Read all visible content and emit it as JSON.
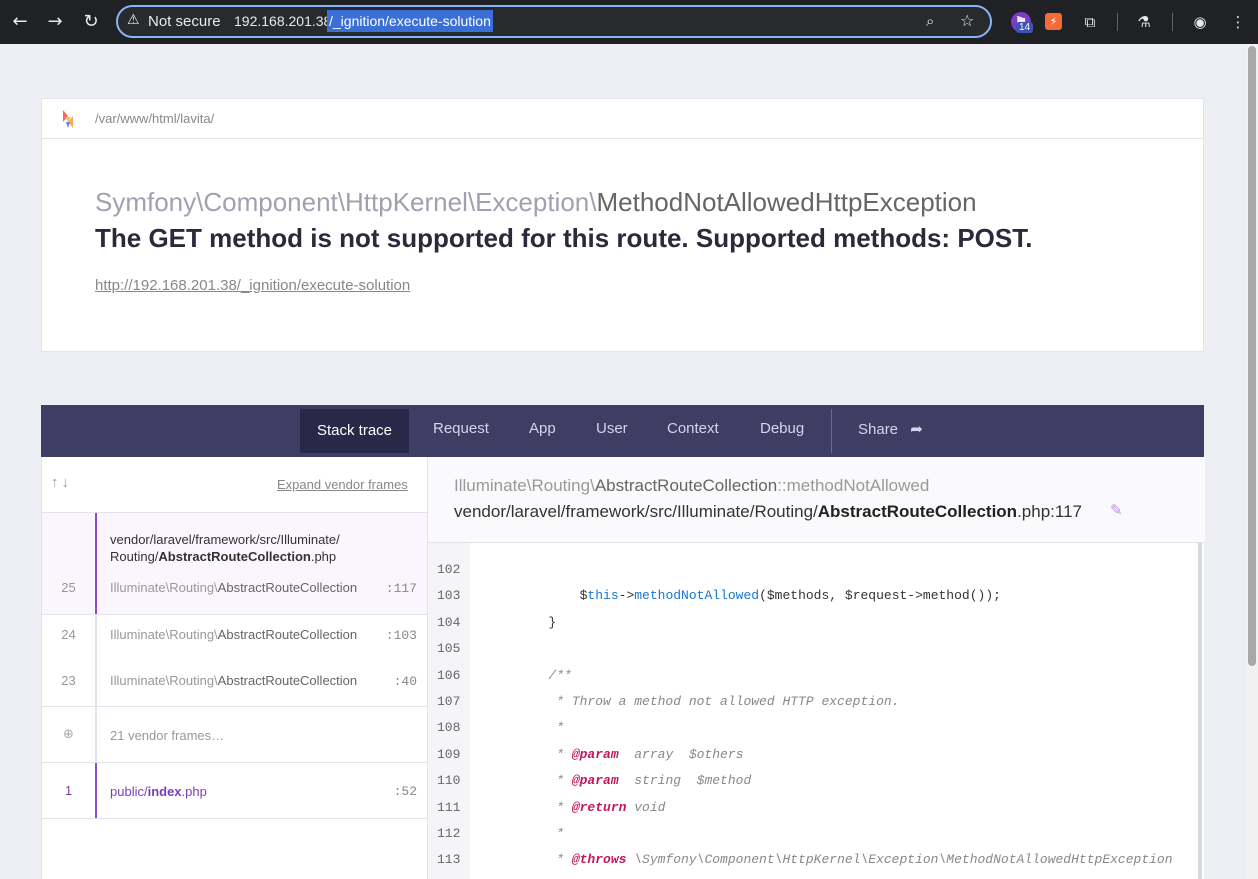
{
  "browser": {
    "security_label": "Not secure",
    "url_host": "192.168.201.38",
    "url_path": "/_ignition/execute-solution",
    "extension_badge": "14"
  },
  "error": {
    "app_path": "/var/www/html/lavita/",
    "exception_namespace": "Symfony\\Component\\HttpKernel\\Exception\\",
    "exception_class": "MethodNotAllowedHttpException",
    "message": "The GET method is not supported for this route. Supported methods: POST.",
    "url": "http://192.168.201.38/_ignition/execute-solution"
  },
  "tabs": [
    {
      "label": "Stack trace"
    },
    {
      "label": "Request"
    },
    {
      "label": "App"
    },
    {
      "label": "User"
    },
    {
      "label": "Context"
    },
    {
      "label": "Debug"
    },
    {
      "label": "Share"
    }
  ],
  "stack": {
    "expand_label": "Expand vendor frames",
    "active_file_line1": "vendor/laravel/framework/src/Illuminate/",
    "active_file_dir": "Routing/",
    "active_file_name": "AbstractRouteCollection",
    "active_file_ext": ".php",
    "frames": [
      {
        "num": "25",
        "ns": "Illuminate\\Routing\\",
        "cls": "AbstractRouteCollection",
        "line": ":117"
      },
      {
        "num": "24",
        "ns": "Illuminate\\Routing\\",
        "cls": "AbstractRouteCollection",
        "line": ":103"
      },
      {
        "num": "23",
        "ns": "Illuminate\\Routing\\",
        "cls": "AbstractRouteCollection",
        "line": ":40"
      }
    ],
    "vendor_frames": "21 vendor frames…",
    "app_frame": {
      "num": "1",
      "dir": "public/",
      "name": "index",
      "ext": ".php",
      "line": ":52"
    }
  },
  "code": {
    "ns": "Illuminate\\Routing\\",
    "cls": "AbstractRouteCollection",
    "method": "::methodNotAllowed",
    "path_prefix": "vendor/laravel/framework/src/Illuminate/Routing/",
    "path_file": "AbstractRouteCollection",
    "path_suffix": ".php:117",
    "lines": [
      {
        "no": "102",
        "text": ""
      },
      {
        "no": "103",
        "text": "            $this->methodNotAllowed($methods, $request->method());"
      },
      {
        "no": "104",
        "text": "        }"
      },
      {
        "no": "105",
        "text": ""
      },
      {
        "no": "106",
        "text": "        /**"
      },
      {
        "no": "107",
        "text": "         * Throw a method not allowed HTTP exception."
      },
      {
        "no": "108",
        "text": "         *"
      },
      {
        "no": "109",
        "text": "         * @param  array  $others"
      },
      {
        "no": "110",
        "text": "         * @param  string  $method"
      },
      {
        "no": "111",
        "text": "         * @return void"
      },
      {
        "no": "112",
        "text": "         *"
      },
      {
        "no": "113",
        "text": "         * @throws \\Symfony\\Component\\HttpKernel\\Exception\\MethodNotAllowedHttpException"
      }
    ]
  }
}
